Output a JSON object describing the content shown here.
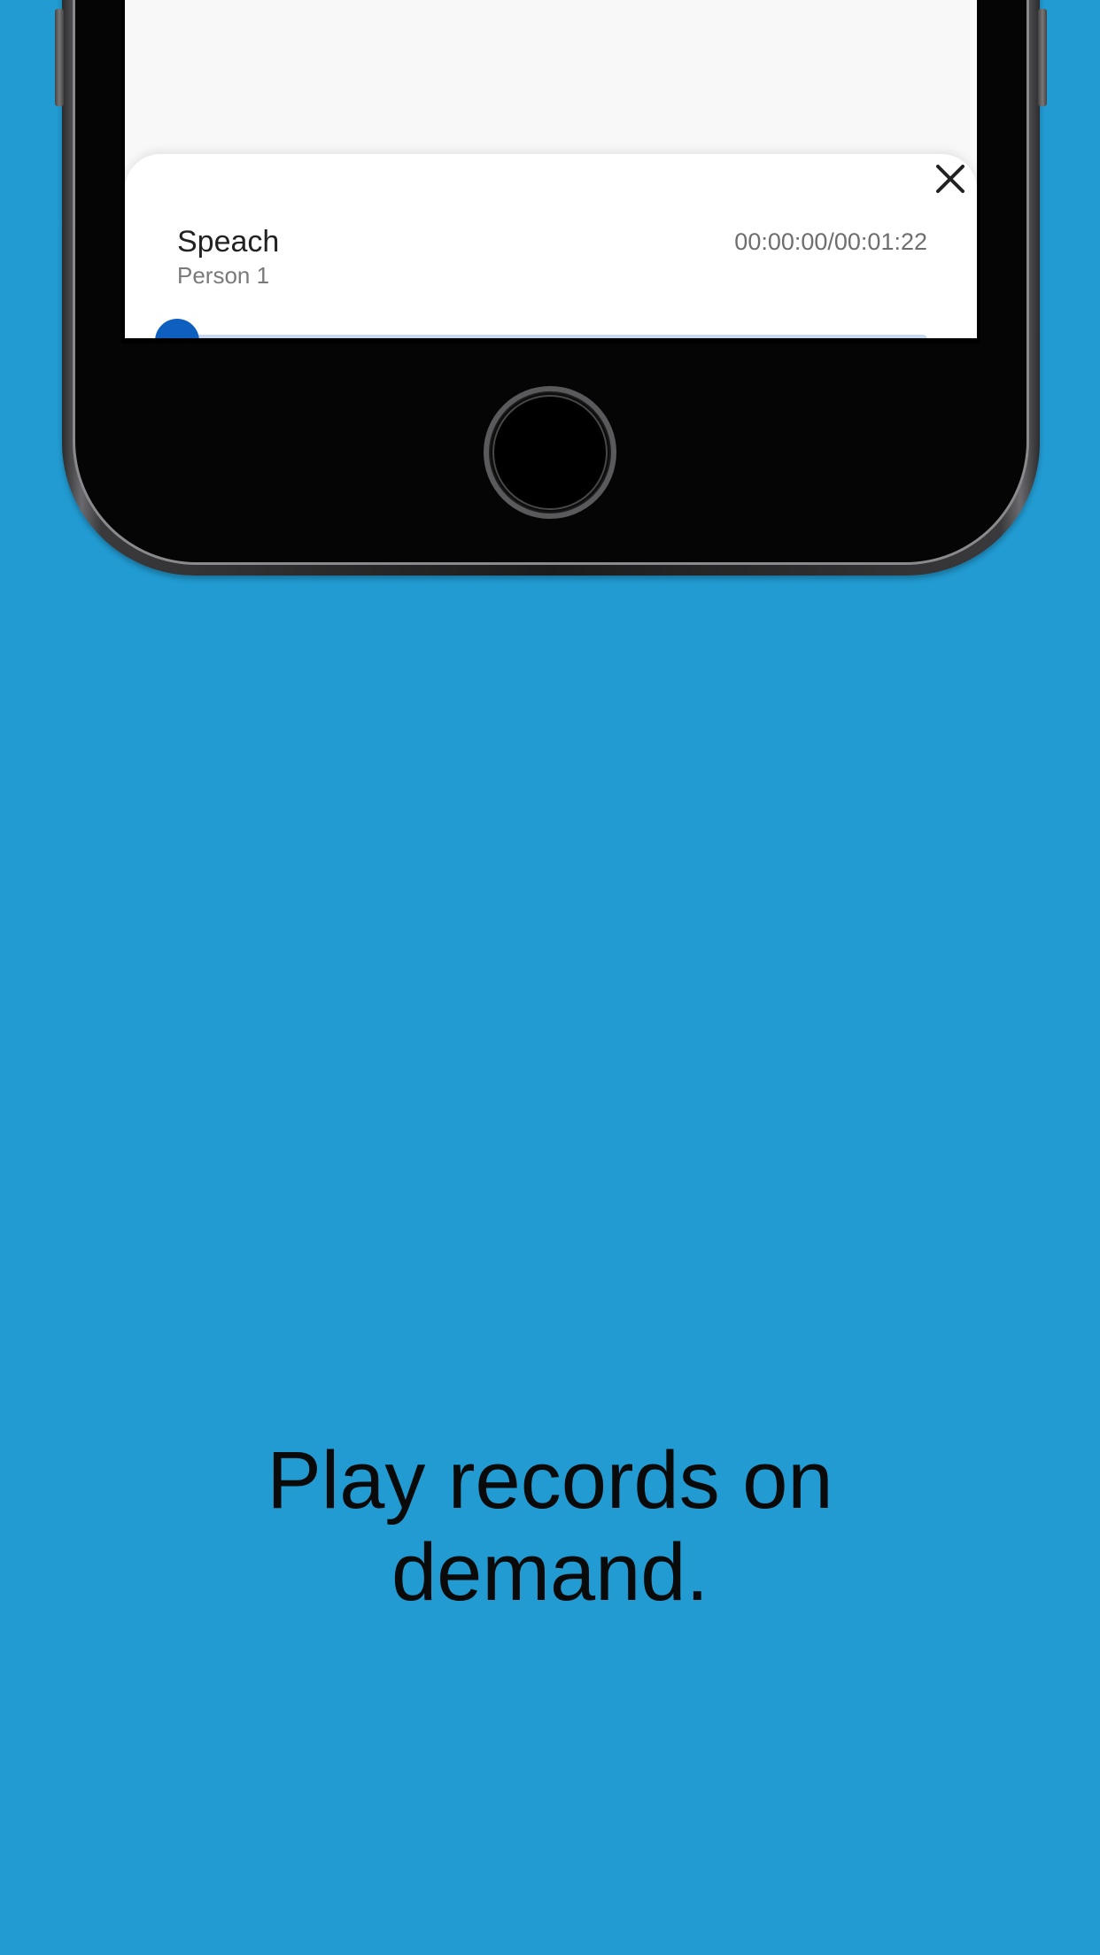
{
  "background_color": "#219bd2",
  "player": {
    "title": "Speach",
    "subtitle": "Person 1",
    "time": "00:00:00/00:01:22",
    "progress": 0,
    "accent_color": "#0f5fc1",
    "close_icon": "close-icon"
  },
  "device": {
    "home_button_icon": "home-button"
  },
  "caption": {
    "line1": "Play records on",
    "line2": "demand."
  }
}
